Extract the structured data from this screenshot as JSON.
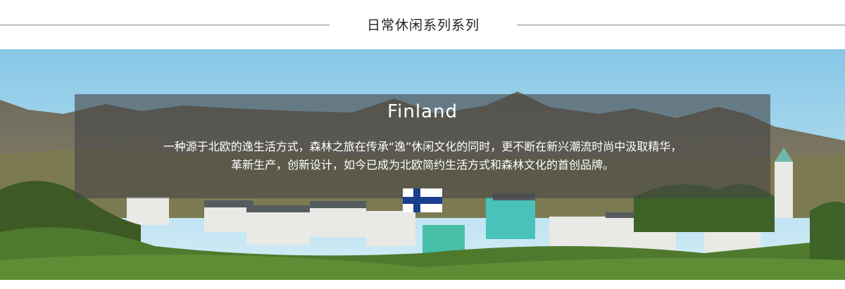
{
  "section": {
    "title": "日常休闲系列系列"
  },
  "banner": {
    "country": "Finland",
    "description_line1": "一种源于北欧的逸生活方式，森林之旅在传承“逸”休闲文化的同时，更不断在新兴潮流时尚中汲取精华，",
    "description_line2": "革新生产，创新设计，如今已成为北欧简约生活方式和森林文化的首创品牌。",
    "flag_icon": "finland-flag-icon",
    "colors": {
      "sky": "#8ecbe6",
      "overlay": "#464646",
      "flag_blue": "#1a3f8f"
    }
  }
}
